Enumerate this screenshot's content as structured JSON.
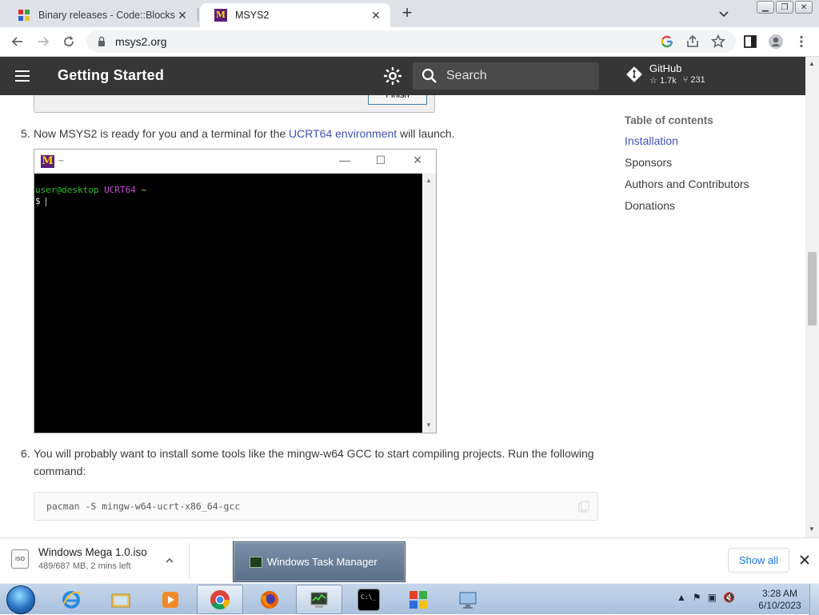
{
  "browser": {
    "tabs": [
      {
        "title": "Binary releases - Code::Blocks",
        "active": false
      },
      {
        "title": "MSYS2",
        "active": true
      }
    ],
    "url": "msys2.org"
  },
  "header": {
    "title": "Getting Started",
    "search_placeholder": "Search",
    "github_label": "GitHub",
    "github_stars": "1.7k",
    "github_forks": "231"
  },
  "content": {
    "installer_finish": "Finish",
    "step5": {
      "num": "5.",
      "text_before": "Now MSYS2 is ready for you and a terminal for the ",
      "link": "UCRT64 environment",
      "text_after": " will launch."
    },
    "terminal": {
      "title": "~",
      "prompt_user": "user@desktop",
      "prompt_env": "UCRT64",
      "prompt_path": "~",
      "prompt_symbol": "$"
    },
    "step6": {
      "num": "6.",
      "line1": "You will probably want to install some tools like the mingw-w64 GCC to start compiling projects. Run the following",
      "line2": "command:"
    },
    "code": "pacman -S mingw-w64-ucrt-x86_64-gcc"
  },
  "toc": {
    "title": "Table of contents",
    "items": [
      {
        "label": "Installation",
        "active": true
      },
      {
        "label": "Sponsors",
        "active": false
      },
      {
        "label": "Authors and Contributors",
        "active": false
      },
      {
        "label": "Donations",
        "active": false
      }
    ]
  },
  "downloads": {
    "file_name": "Windows Mega 1.0.iso",
    "icon_label": "ISO",
    "status": "489/687 MB, 2 mins left",
    "show_all": "Show all"
  },
  "taskbar": {
    "popup": "Windows Task Manager",
    "time": "3:28 AM",
    "date": "6/10/2023",
    "cmd_label": "C:\\_"
  },
  "colors": {
    "header_bg": "#363636",
    "link": "#3f51b5",
    "download_accent": "#1a73e8"
  }
}
